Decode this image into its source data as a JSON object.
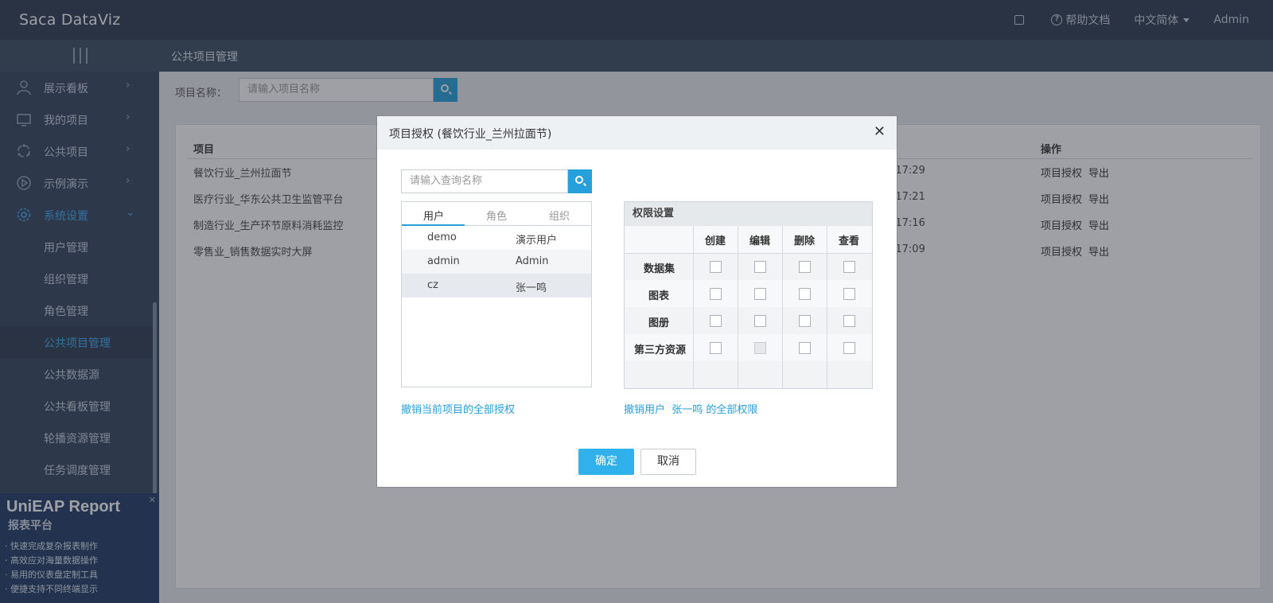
{
  "header": {
    "logo": "Saᴄa DataViz",
    "help": "帮助文档",
    "language": "中文简体",
    "user": "Admin"
  },
  "breadcrumb": "公共项目管理",
  "sidebar": {
    "items": [
      {
        "label": "展示看板",
        "icon": "user-icon"
      },
      {
        "label": "我的项目",
        "icon": "monitor-icon"
      },
      {
        "label": "公共项目",
        "icon": "circle-dots-icon"
      },
      {
        "label": "示例演示",
        "icon": "play-icon"
      },
      {
        "label": "系统设置",
        "icon": "gear-icon"
      }
    ],
    "subitems": [
      "用户管理",
      "组织管理",
      "角色管理",
      "公共项目管理",
      "公共数据源",
      "公共看板管理",
      "轮播资源管理",
      "任务调度管理"
    ]
  },
  "ad": {
    "title": "UniEAP Report",
    "subtitle": "报表平台",
    "lines": [
      "· 快速完成复杂报表制作",
      "· 高效应对海量数据操作",
      "· 易用的仪表盘定制工具",
      "· 便捷支持不同终端显示"
    ]
  },
  "search": {
    "label": "项目名称：",
    "placeholder": "请输入项目名称"
  },
  "table": {
    "headers": {
      "project": "项目",
      "ops": "操作"
    },
    "rows": [
      {
        "name": "餐饮行业_兰州拉面节",
        "time": ":17:29",
        "op1": "项目授权",
        "op2": "导出"
      },
      {
        "name": "医疗行业_华东公共卫生监管平台",
        "time": ":17:21",
        "op1": "项目授权",
        "op2": "导出"
      },
      {
        "name": "制造行业_生产环节原料消耗监控",
        "time": ":17:16",
        "op1": "项目授权",
        "op2": "导出"
      },
      {
        "name": "零售业_销售数据实时大屏",
        "time": ":17:09",
        "op1": "项目授权",
        "op2": "导出"
      }
    ]
  },
  "modal": {
    "title": "项目授权 (餐饮行业_兰州拉面节)",
    "search_placeholder": "请输入查询名称",
    "tabs": [
      "用户",
      "角色",
      "组织"
    ],
    "users": [
      {
        "id": "demo",
        "name": "演示用户"
      },
      {
        "id": "admin",
        "name": "Admin"
      },
      {
        "id": "cz",
        "name": "张一鸣"
      }
    ],
    "perm_title": "权限设置",
    "perm_cols": [
      "创建",
      "编辑",
      "删除",
      "查看"
    ],
    "perm_rows": [
      "数据集",
      "图表",
      "图册",
      "第三方资源"
    ],
    "revoke_all": "撤销当前项目的全部授权",
    "revoke_user": "撤销用户  张一鸣 的全部权限",
    "ok": "确定",
    "cancel": "取消"
  },
  "colors": {
    "accent": "#26a0da",
    "header": "#2b3a4d",
    "sidebar": "#32435a"
  }
}
